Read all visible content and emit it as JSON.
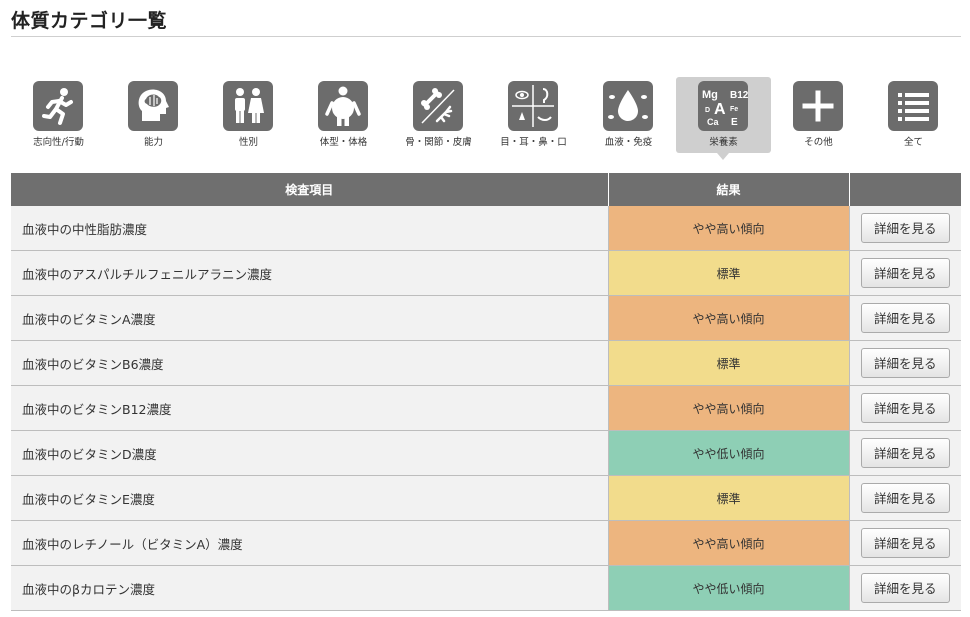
{
  "page": {
    "title": "体質カテゴリ一覧"
  },
  "categories": [
    {
      "label": "志向性/行動",
      "icon": "running-person-icon",
      "active": false
    },
    {
      "label": "能力",
      "icon": "brain-head-icon",
      "active": false
    },
    {
      "label": "性別",
      "icon": "male-female-icon",
      "active": false
    },
    {
      "label": "体型・体格",
      "icon": "body-shape-icon",
      "active": false
    },
    {
      "label": "骨・関節・皮膚",
      "icon": "bone-skin-icon",
      "active": false
    },
    {
      "label": "目・耳・鼻・口",
      "icon": "face-senses-icon",
      "active": false
    },
    {
      "label": "血液・免疫",
      "icon": "blood-drop-icon",
      "active": false
    },
    {
      "label": "栄養素",
      "icon": "nutrients-icon",
      "active": true,
      "icon_text": [
        "Mg",
        "B12",
        "D",
        "A",
        "Fe",
        "Ca",
        "E"
      ]
    },
    {
      "label": "その他",
      "icon": "plus-icon",
      "active": false
    },
    {
      "label": "全て",
      "icon": "list-icon",
      "active": false
    }
  ],
  "table": {
    "headers": [
      "検査項目",
      "結果",
      ""
    ],
    "detail_label": "詳細を見る",
    "status_colors": {
      "やや高い傾向": "#edb57f",
      "標準": "#f2dc8c",
      "やや低い傾向": "#8ecfb5"
    },
    "rows": [
      {
        "item": "血液中の中性脂肪濃度",
        "result": "やや高い傾向"
      },
      {
        "item": "血液中のアスパルチルフェニルアラニン濃度",
        "result": "標準"
      },
      {
        "item": "血液中のビタミンA濃度",
        "result": "やや高い傾向"
      },
      {
        "item": "血液中のビタミンB6濃度",
        "result": "標準"
      },
      {
        "item": "血液中のビタミンB12濃度",
        "result": "やや高い傾向"
      },
      {
        "item": "血液中のビタミンD濃度",
        "result": "やや低い傾向"
      },
      {
        "item": "血液中のビタミンE濃度",
        "result": "標準"
      },
      {
        "item": "血液中のレチノール（ビタミンA）濃度",
        "result": "やや高い傾向"
      },
      {
        "item": "血液中のβカロテン濃度",
        "result": "やや低い傾向"
      }
    ]
  }
}
